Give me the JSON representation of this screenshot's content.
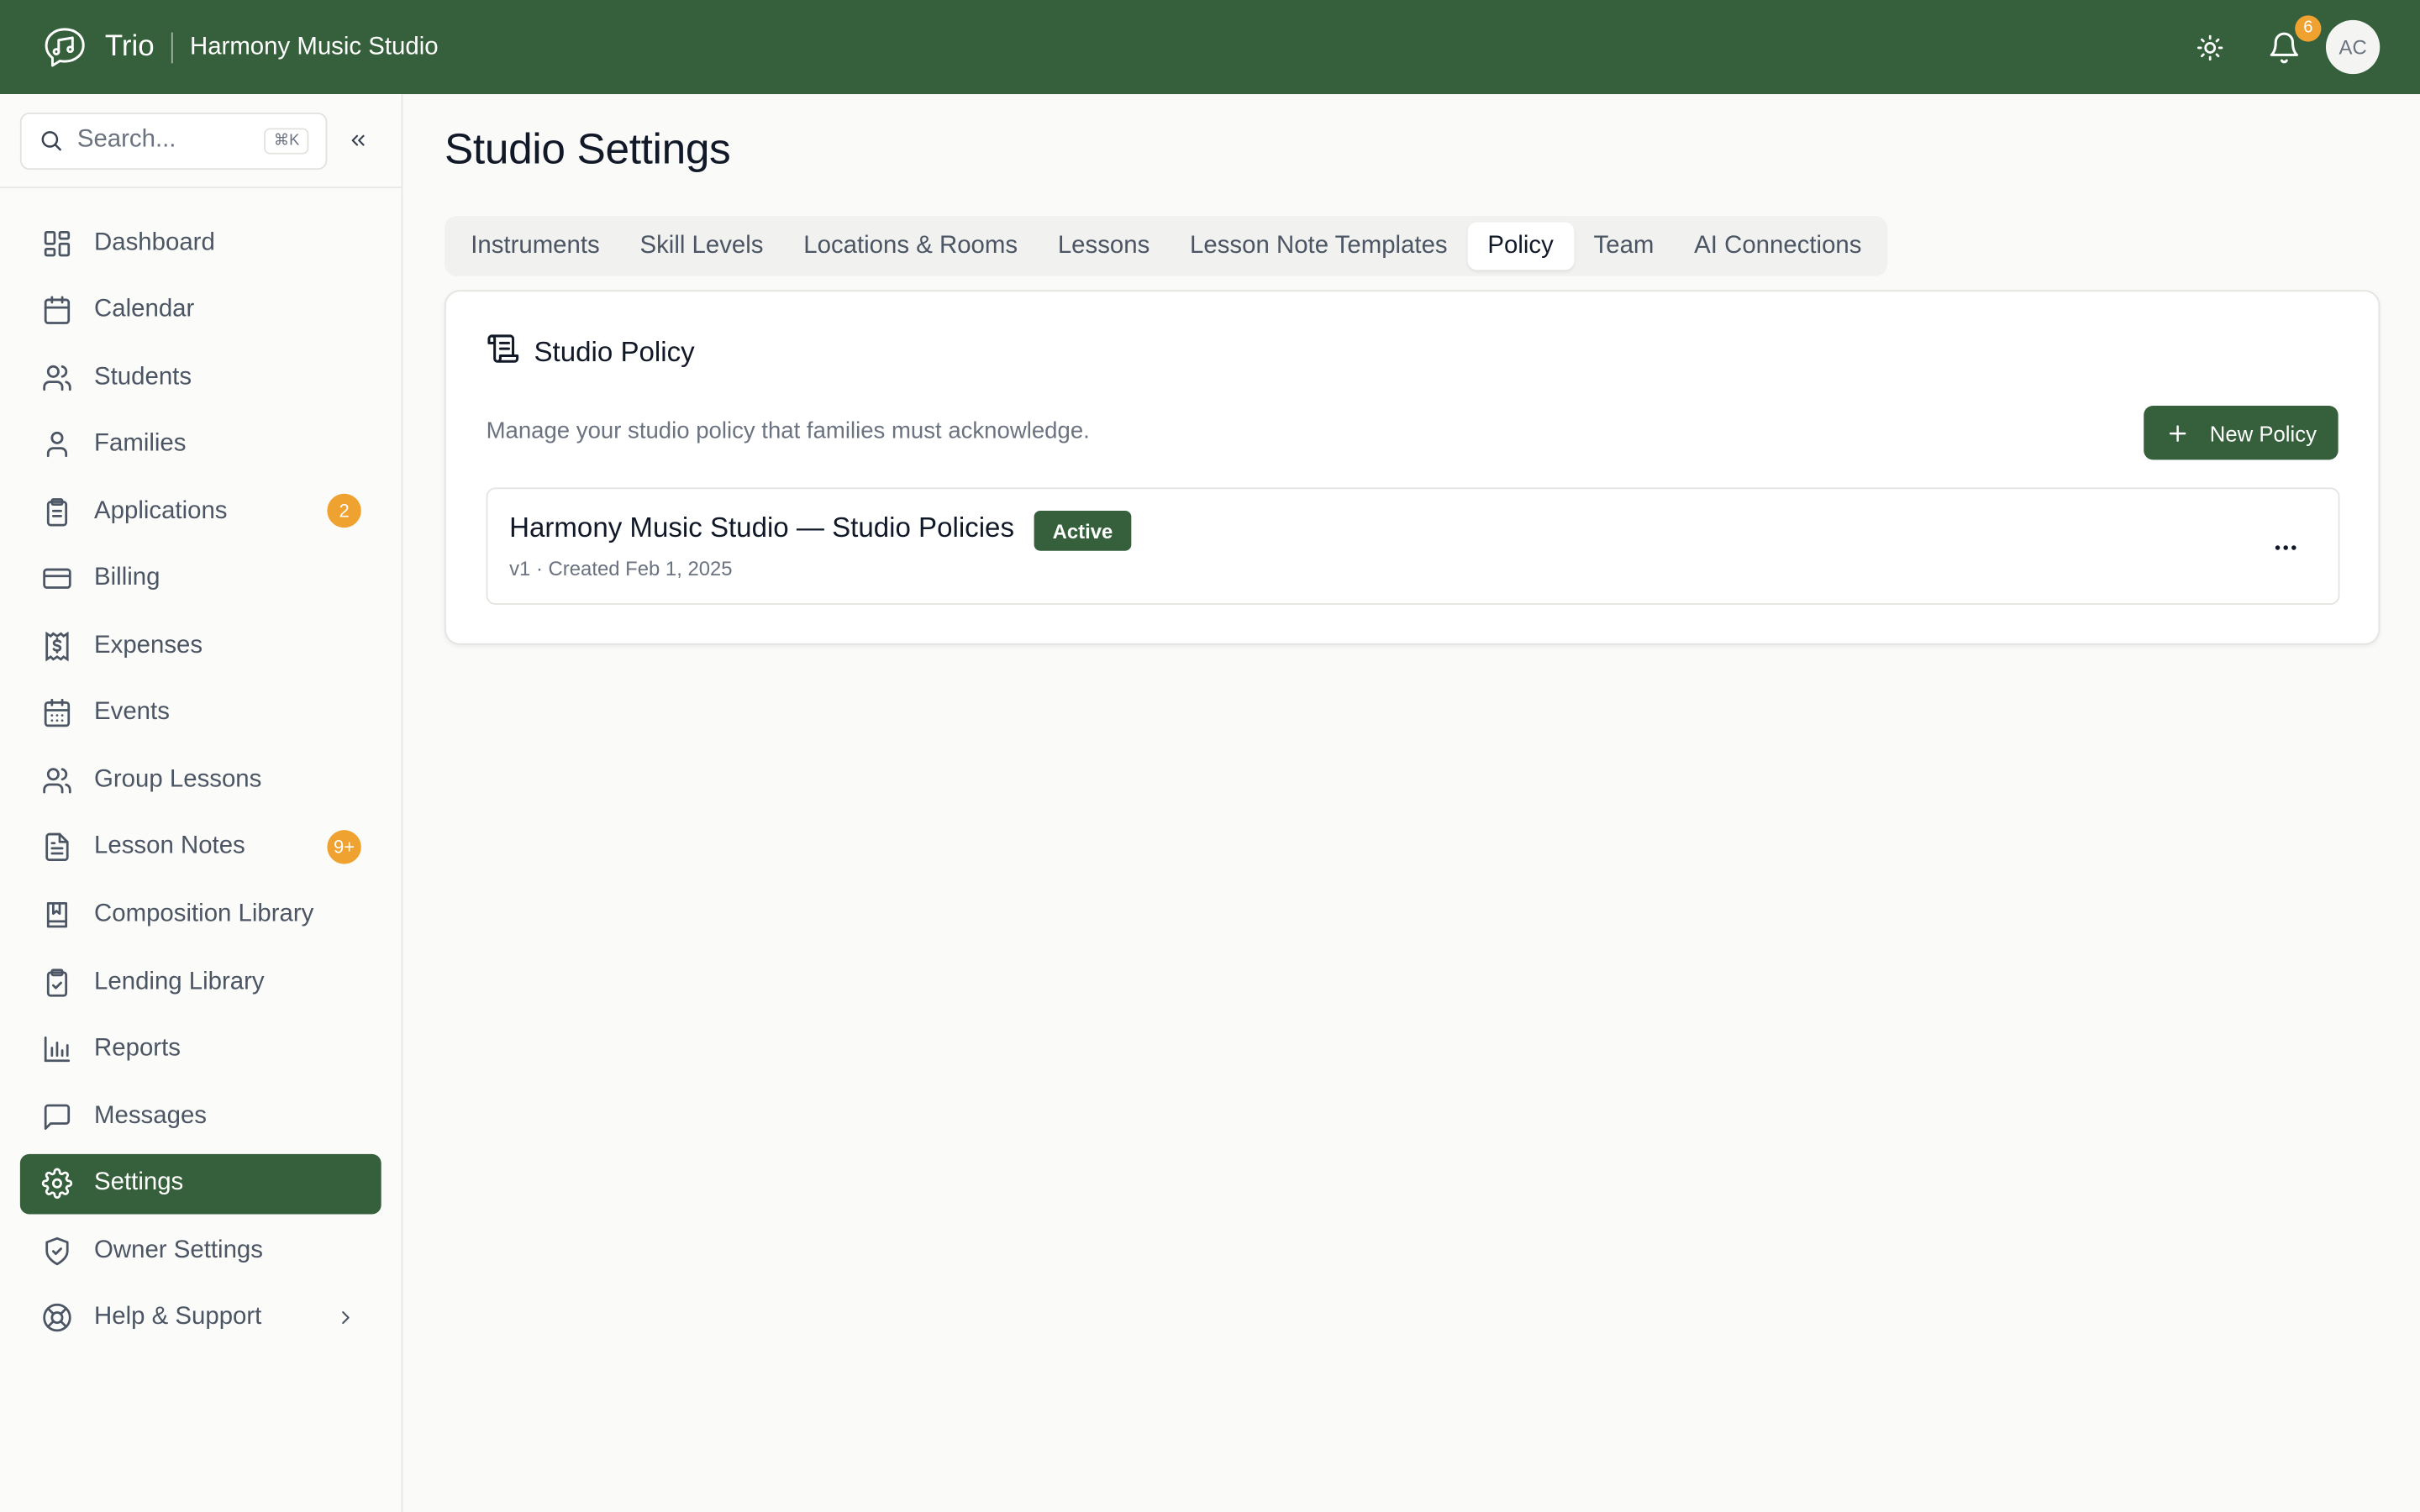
{
  "topbar": {
    "app_name": "Trio",
    "studio_name": "Harmony Music Studio",
    "notification_count": "6",
    "avatar_initials": "AC",
    "brand_color": "#35603b",
    "badge_color": "#f0a230"
  },
  "sidebar": {
    "search_placeholder": "Search...",
    "search_shortcut": "⌘K",
    "items": [
      {
        "label": "Dashboard",
        "icon": "dashboard-icon"
      },
      {
        "label": "Calendar",
        "icon": "calendar-icon"
      },
      {
        "label": "Students",
        "icon": "users-icon"
      },
      {
        "label": "Families",
        "icon": "user-icon"
      },
      {
        "label": "Applications",
        "icon": "clipboard-icon",
        "badge": "2"
      },
      {
        "label": "Billing",
        "icon": "credit-card-icon"
      },
      {
        "label": "Expenses",
        "icon": "receipt-icon"
      },
      {
        "label": "Events",
        "icon": "calendar-grid-icon"
      },
      {
        "label": "Group Lessons",
        "icon": "users-icon"
      },
      {
        "label": "Lesson Notes",
        "icon": "file-text-icon",
        "badge": "9+"
      },
      {
        "label": "Composition Library",
        "icon": "book-icon"
      },
      {
        "label": "Lending Library",
        "icon": "clipboard-check-icon"
      },
      {
        "label": "Reports",
        "icon": "bar-chart-icon"
      },
      {
        "label": "Messages",
        "icon": "message-square-icon"
      },
      {
        "label": "Settings",
        "icon": "gear-icon",
        "active": true
      },
      {
        "label": "Owner Settings",
        "icon": "shield-check-icon"
      },
      {
        "label": "Help & Support",
        "icon": "life-buoy-icon",
        "chevron": true
      }
    ]
  },
  "main": {
    "page_title": "Studio Settings",
    "tabs": [
      {
        "label": "Instruments"
      },
      {
        "label": "Skill Levels"
      },
      {
        "label": "Locations & Rooms"
      },
      {
        "label": "Lessons"
      },
      {
        "label": "Lesson Note Templates"
      },
      {
        "label": "Policy",
        "active": true
      },
      {
        "label": "Team"
      },
      {
        "label": "AI Connections"
      }
    ],
    "card": {
      "title": "Studio Policy",
      "description": "Manage your studio policy that families must acknowledge.",
      "new_button_label": "New Policy",
      "policy": {
        "name": "Harmony Music Studio — Studio Policies",
        "status": "Active",
        "meta": "v1 · Created Feb 1, 2025"
      }
    }
  }
}
